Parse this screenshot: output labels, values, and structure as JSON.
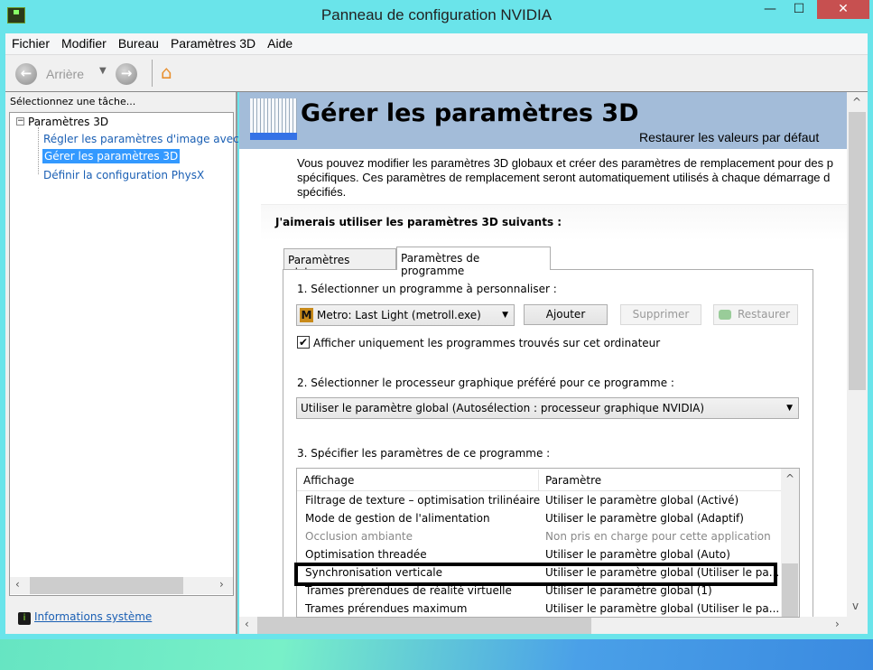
{
  "window": {
    "title": "Panneau de configuration NVIDIA",
    "minimize": "—",
    "maximize": "☐",
    "close": "✕"
  },
  "menu": [
    "Fichier",
    "Modifier",
    "Bureau",
    "Paramètres 3D",
    "Aide"
  ],
  "toolbar": {
    "back_label": "Arrière"
  },
  "sidebar": {
    "header": "Sélectionnez une tâche...",
    "root": "Paramètres 3D",
    "items": [
      {
        "label": "Régler les paramètres d'image avec"
      },
      {
        "label": "Gérer les paramètres 3D",
        "selected": true
      },
      {
        "label": "Définir la configuration PhysX"
      }
    ],
    "system_info": "Informations système"
  },
  "page": {
    "title": "Gérer les paramètres 3D",
    "restore_defaults": "Restaurer les valeurs par défaut",
    "description": [
      "Vous pouvez modifier les paramètres 3D globaux et créer des paramètres de remplacement pour des p",
      "spécifiques. Ces paramètres de remplacement seront automatiquement utilisés à chaque démarrage d",
      "spécifiés."
    ],
    "section_heading": "J'aimerais utiliser les paramètres 3D suivants :",
    "tabs": [
      "Paramètres globaux",
      "Paramètres de programme"
    ],
    "step1": "1. Sélectionner un programme à personnaliser :",
    "program": "Metro: Last Light (metroll.exe)",
    "add": "Ajouter",
    "remove": "Supprimer",
    "restore": "Restaurer",
    "checkbox_label": "Afficher uniquement les programmes trouvés sur cet ordinateur",
    "checkbox_checked": true,
    "step2": "2. Sélectionner le processeur graphique préféré pour ce programme :",
    "gpu": "Utiliser le paramètre global (Autosélection : processeur graphique NVIDIA)",
    "step3": "3. Spécifier les paramètres de ce programme :",
    "columns": [
      "Affichage",
      "Paramètre"
    ],
    "rows": [
      {
        "feature": "Filtrage de texture – optimisation trilinéaire",
        "setting": "Utiliser le paramètre global (Activé)"
      },
      {
        "feature": "Mode de gestion de l'alimentation",
        "setting": "Utiliser le paramètre global (Adaptif)"
      },
      {
        "feature": "Occlusion ambiante",
        "setting": "Non pris en charge pour cette application",
        "disabled": true
      },
      {
        "feature": "Optimisation threadée",
        "setting": "Utiliser le paramètre global (Auto)"
      },
      {
        "feature": "Synchronisation verticale",
        "setting": "Utiliser le paramètre global (Utiliser le pa...",
        "highlighted": true
      },
      {
        "feature": "Trames prérendues de réalité virtuelle",
        "setting": "Utiliser le paramètre global (1)"
      },
      {
        "feature": "Trames prérendues maximum",
        "setting": "Utiliser le paramètre global (Utiliser le pa..."
      }
    ]
  }
}
